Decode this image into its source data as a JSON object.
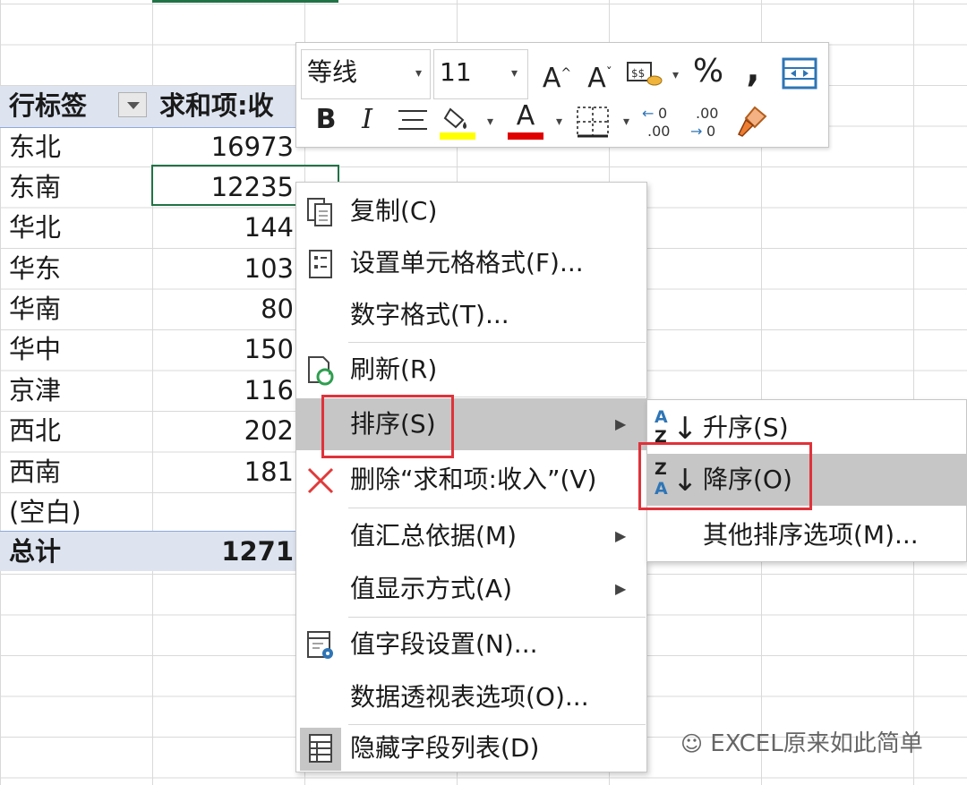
{
  "sheet": {
    "header": {
      "row_label": "行标签",
      "value_label": "求和项:收"
    },
    "rows": [
      {
        "label": "东北",
        "value": "16973"
      },
      {
        "label": "东南",
        "value": "12235"
      },
      {
        "label": "华北",
        "value": "144"
      },
      {
        "label": "华东",
        "value": "103"
      },
      {
        "label": "华南",
        "value": "80"
      },
      {
        "label": "华中",
        "value": "150"
      },
      {
        "label": "京津",
        "value": "116"
      },
      {
        "label": "西北",
        "value": "202"
      },
      {
        "label": "西南",
        "value": "181"
      },
      {
        "label": "(空白)",
        "value": ""
      }
    ],
    "total": {
      "label": "总计",
      "value": "1271"
    }
  },
  "mini_toolbar": {
    "font_name": "等线",
    "font_size": "11",
    "percent": "%",
    "comma": ",",
    "bold": "B",
    "italic": "I",
    "font_color_letter": "A",
    "increase_decimal": "←0\n.00",
    "decrease_decimal": ".00\n→0",
    "grow_font": "A",
    "shrink_font": "A",
    "highlight_color": "#ffff00",
    "font_color": "#e00000"
  },
  "context_menu": {
    "copy": "复制(C)",
    "format_cells": "设置单元格格式(F)...",
    "number_format": "数字格式(T)...",
    "refresh": "刷新(R)",
    "sort": "排序(S)",
    "remove_field": "删除“求和项:收入”(V)",
    "summarize_by": "值汇总依据(M)",
    "show_values_as": "值显示方式(A)",
    "field_settings": "值字段设置(N)...",
    "pivot_options": "数据透视表选项(O)...",
    "hide_field_list": "隐藏字段列表(D)"
  },
  "sort_submenu": {
    "ascending": "升序(S)",
    "descending": "降序(O)",
    "more_options": "其他排序选项(M)..."
  },
  "icons": {
    "copy": "copy-icon",
    "format_cells": "format-cells-icon",
    "refresh": "refresh-icon",
    "remove": "delete-x-icon",
    "field_settings": "field-settings-icon",
    "field_list": "field-list-icon"
  },
  "colors": {
    "highlight": "#c6c6c6",
    "callout_red": "#e0323a",
    "accent_green": "#217346",
    "band_blue": "#dde4f0"
  },
  "watermark": "EXCEL原来如此简单"
}
